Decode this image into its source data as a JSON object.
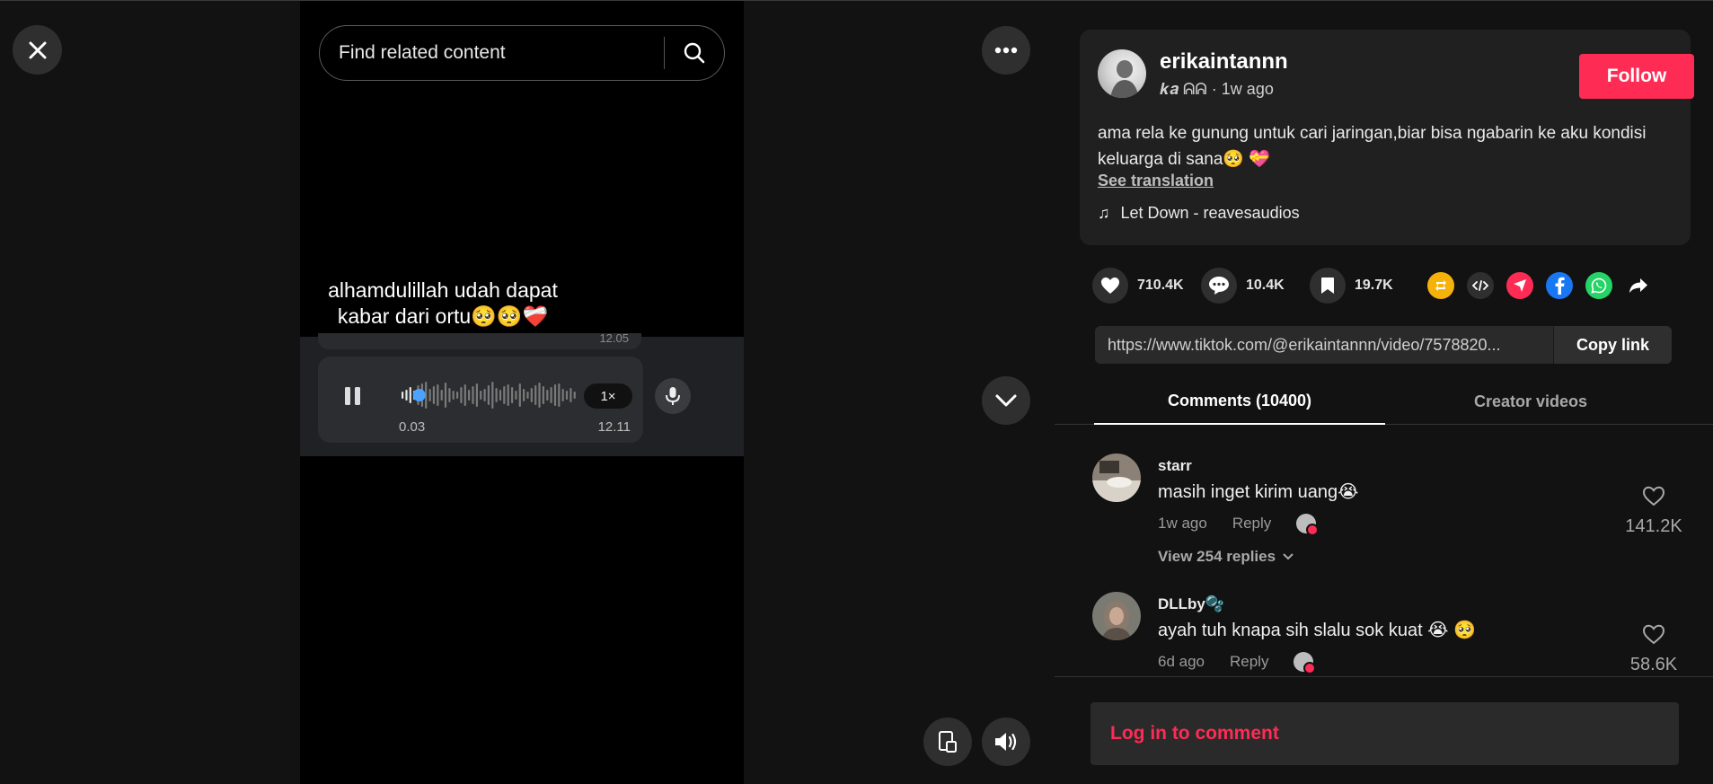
{
  "player": {
    "search": {
      "placeholder": "Find related content"
    },
    "caption_line1": "alhamdulillah udah dapat",
    "caption_line2": "kabar dari ortu🥺🥺❤️‍🩹",
    "voice_note": {
      "prev_time": "12.05",
      "speed": "1×",
      "current_time": "0.03",
      "duration": "12.11",
      "progress": 0.08
    }
  },
  "author": {
    "username": "erikaintannn",
    "nickname": "𝒌𝒂 ᕱᕱ",
    "time_ago": "1w ago",
    "follow_label": "Follow",
    "description": "ama rela ke gunung untuk cari jaringan,biar bisa ngabarin ke aku kondisi keluarga di sana🥺 💝",
    "see_translation": "See translation",
    "music": "Let Down - reavesaudios"
  },
  "actions": {
    "likes": "710.4K",
    "comments": "10.4K",
    "saves": "19.7K"
  },
  "share": {
    "link": "https://www.tiktok.com/@erikaintannn/video/7578820...",
    "copy_label": "Copy link"
  },
  "tabs": {
    "comments": "Comments (10400)",
    "creator_videos": "Creator videos"
  },
  "comments": [
    {
      "user": "starr",
      "text": "masih inget kirim uang😭",
      "time": "1w ago",
      "reply": "Reply",
      "likes": "141.2K",
      "view_replies": "View 254 replies"
    },
    {
      "user": "DLLby🫧",
      "text": "ayah tuh knapa sih slalu sok kuat 😭 🥺",
      "time": "6d ago",
      "reply": "Reply",
      "likes": "58.6K"
    }
  ],
  "login_prompt": "Log in to comment",
  "colors": {
    "accent": "#fe2c55",
    "background": "#121212",
    "card": "#202020"
  }
}
